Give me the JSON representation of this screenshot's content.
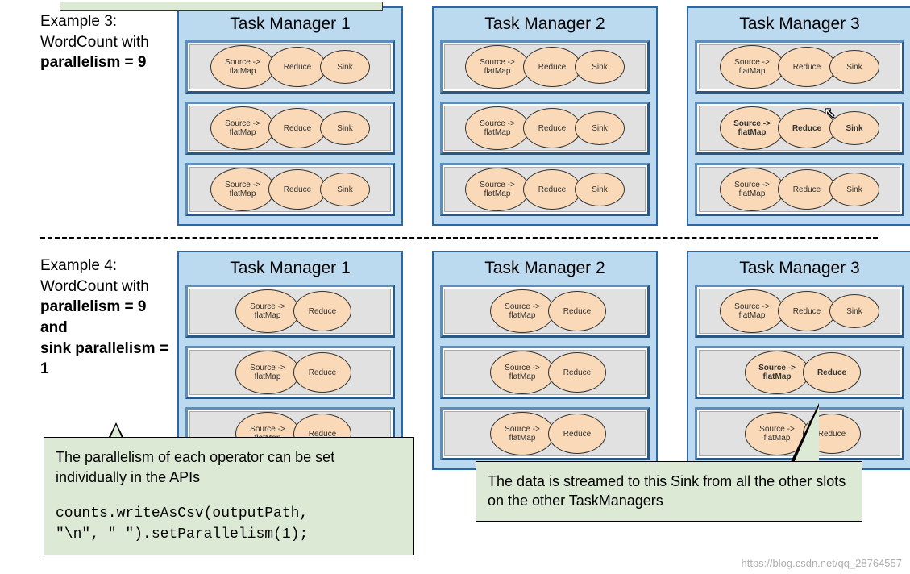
{
  "examples": [
    {
      "title_line1": "Example 3:",
      "title_line2": "WordCount with",
      "title_line3": "parallelism = 9",
      "task_managers": [
        {
          "title": "Task Manager 1",
          "slots": [
            {
              "ops": [
                "Source -> flatMap",
                "Reduce",
                "Sink"
              ],
              "bold": false
            },
            {
              "ops": [
                "Source -> flatMap",
                "Reduce",
                "Sink"
              ],
              "bold": false
            },
            {
              "ops": [
                "Source -> flatMap",
                "Reduce",
                "Sink"
              ],
              "bold": false
            }
          ]
        },
        {
          "title": "Task Manager 2",
          "slots": [
            {
              "ops": [
                "Source -> flatMap",
                "Reduce",
                "Sink"
              ],
              "bold": false
            },
            {
              "ops": [
                "Source -> flatMap",
                "Reduce",
                "Sink"
              ],
              "bold": false
            },
            {
              "ops": [
                "Source -> flatMap",
                "Reduce",
                "Sink"
              ],
              "bold": false
            }
          ]
        },
        {
          "title": "Task Manager 3",
          "slots": [
            {
              "ops": [
                "Source -> flatMap",
                "Reduce",
                "Sink"
              ],
              "bold": false
            },
            {
              "ops": [
                "Source -> flatMap",
                "Reduce",
                "Sink"
              ],
              "bold": true
            },
            {
              "ops": [
                "Source -> flatMap",
                "Reduce",
                "Sink"
              ],
              "bold": false
            }
          ]
        }
      ]
    },
    {
      "title_line1": "Example 4:",
      "title_line2": "WordCount with",
      "title_line3": "parallelism = 9 and",
      "title_line4": "sink parallelism = 1",
      "task_managers": [
        {
          "title": "Task Manager 1",
          "slots": [
            {
              "ops": [
                "Source -> flatMap",
                "Reduce"
              ],
              "bold": false
            },
            {
              "ops": [
                "Source -> flatMap",
                "Reduce"
              ],
              "bold": false
            },
            {
              "ops": [
                "Source -> flatMap",
                "Reduce"
              ],
              "bold": false
            }
          ]
        },
        {
          "title": "Task Manager 2",
          "slots": [
            {
              "ops": [
                "Source -> flatMap",
                "Reduce"
              ],
              "bold": false
            },
            {
              "ops": [
                "Source -> flatMap",
                "Reduce"
              ],
              "bold": false
            },
            {
              "ops": [
                "Source -> flatMap",
                "Reduce"
              ],
              "bold": false
            }
          ]
        },
        {
          "title": "Task Manager 3",
          "slots": [
            {
              "ops": [
                "Source -> flatMap",
                "Reduce",
                "Sink"
              ],
              "bold": false
            },
            {
              "ops": [
                "Source -> flatMap",
                "Reduce"
              ],
              "bold": true
            },
            {
              "ops": [
                "Source -> flatMap",
                "Reduce"
              ],
              "bold": false
            }
          ]
        }
      ]
    }
  ],
  "callout1_text": "The parallelism of each operator can be set individually in the APIs",
  "callout1_code": "counts.writeAsCsv(outputPath,\n\"\\n\", \" \").setParallelism(1);",
  "callout2_text": "The data is streamed to this Sink from all the other slots on the other TaskManagers",
  "watermark": "https://blog.csdn.net/qq_28764557"
}
